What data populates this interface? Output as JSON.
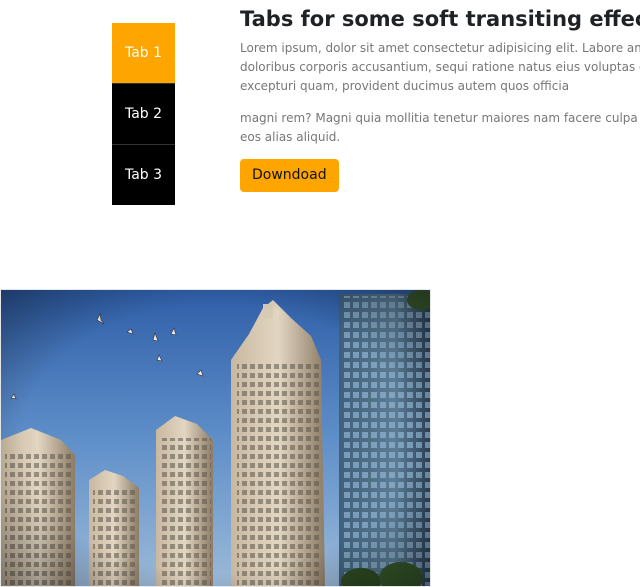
{
  "tabs": [
    {
      "label": "Tab 1",
      "active": true
    },
    {
      "label": "Tab 2",
      "active": false
    },
    {
      "label": "Tab 3",
      "active": false
    }
  ],
  "content": {
    "title": "Tabs for some soft transiting effects",
    "paragraph1": "Lorem ipsum, dolor sit amet consectetur adipisicing elit. Labore amet\ndoloribus corporis accusantium, sequi ratione natus eius voluptas opt\nexcepturi quam, provident ducimus autem quos officia",
    "paragraph2": "magni rem? Magni quia mollitia tenetur maiores nam facere culpa pla\neos alias aliquid.",
    "download_label": "Downdoad"
  },
  "colors": {
    "accent": "#ffa500",
    "tab_background": "#000000",
    "tab_text": "#ffffff"
  },
  "image": {
    "subject": "high-rise-towers-photo"
  }
}
